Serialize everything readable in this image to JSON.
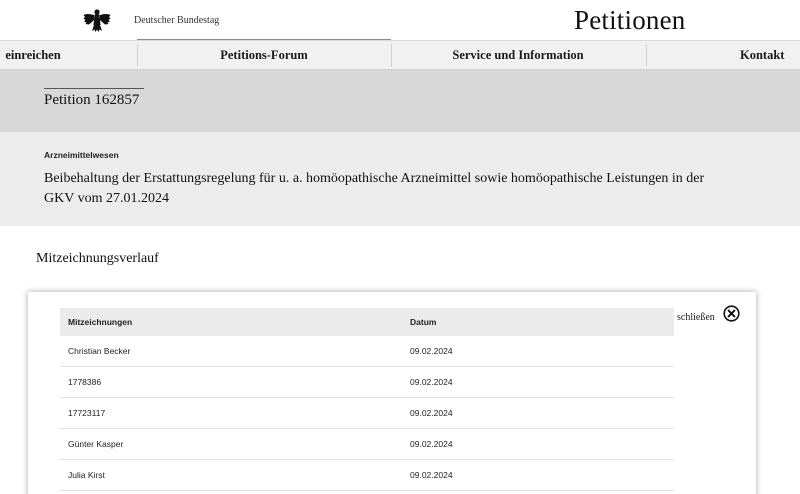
{
  "header": {
    "brand": "Deutscher Bundestag",
    "site_title": "Petitionen",
    "logo_icon": "bundesadler-eagle-icon"
  },
  "nav": {
    "items": [
      {
        "label": "einreichen"
      },
      {
        "label": "Petitions-Forum",
        "active": true
      },
      {
        "label": "Service und Information"
      },
      {
        "label": "Kontakt"
      }
    ],
    "accent_color": "#e2732c"
  },
  "petition": {
    "number": "Petition 162857",
    "category": "Arzneimittelwesen",
    "subject": "Beibehaltung der Erstattungsregelung für u. a. homöopathische Arzneimittel sowie homöopathische Leistungen in der GKV vom 27.01.2024"
  },
  "section": {
    "heading": "Mitzeichnungsverlauf"
  },
  "modal": {
    "close_label": "schließen",
    "close_icon": "close-circle-icon",
    "table": {
      "headers": [
        "Mitzeichnungen",
        "Datum"
      ],
      "rows": [
        [
          "Christian Becker",
          "09.02.2024"
        ],
        [
          "1778386",
          "09.02.2024"
        ],
        [
          "17723117",
          "09.02.2024"
        ],
        [
          "Günter Kasper",
          "09.02.2024"
        ],
        [
          "Julia Kirst",
          "09.02.2024"
        ]
      ]
    }
  }
}
